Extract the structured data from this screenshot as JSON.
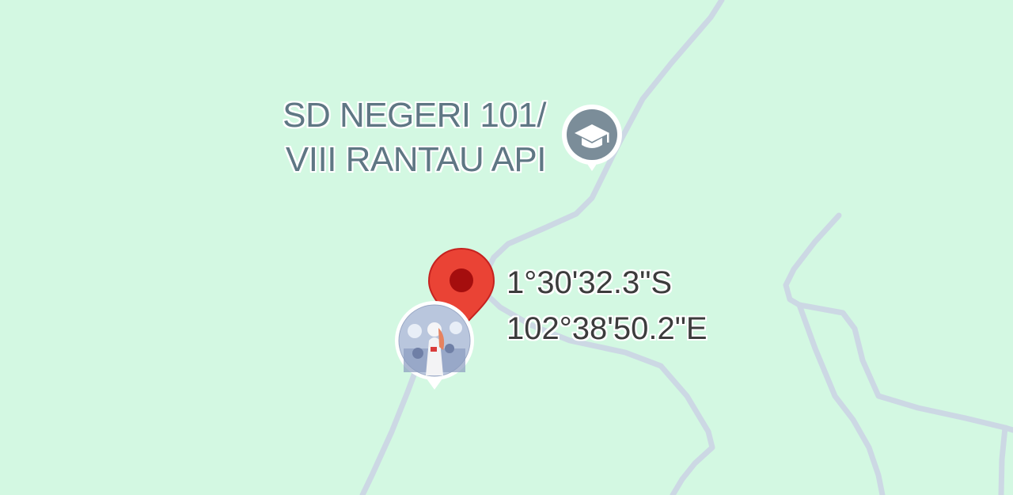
{
  "map": {
    "background_color": "#d3f8e2",
    "road_color": "#ccd8e4"
  },
  "poi": {
    "name_line1": "SD NEGERI 101/",
    "name_line2": "VIII RANTAU API",
    "icon": "school-graduation-cap-icon",
    "icon_color": "#7b8d99"
  },
  "dropped_pin": {
    "icon": "red-location-pin-icon",
    "color": "#ea4335",
    "latitude": "1°30'32.3\"S",
    "longitude": "102°38'50.2\"E"
  },
  "user_avatar": {
    "icon": "user-avatar-icon"
  }
}
